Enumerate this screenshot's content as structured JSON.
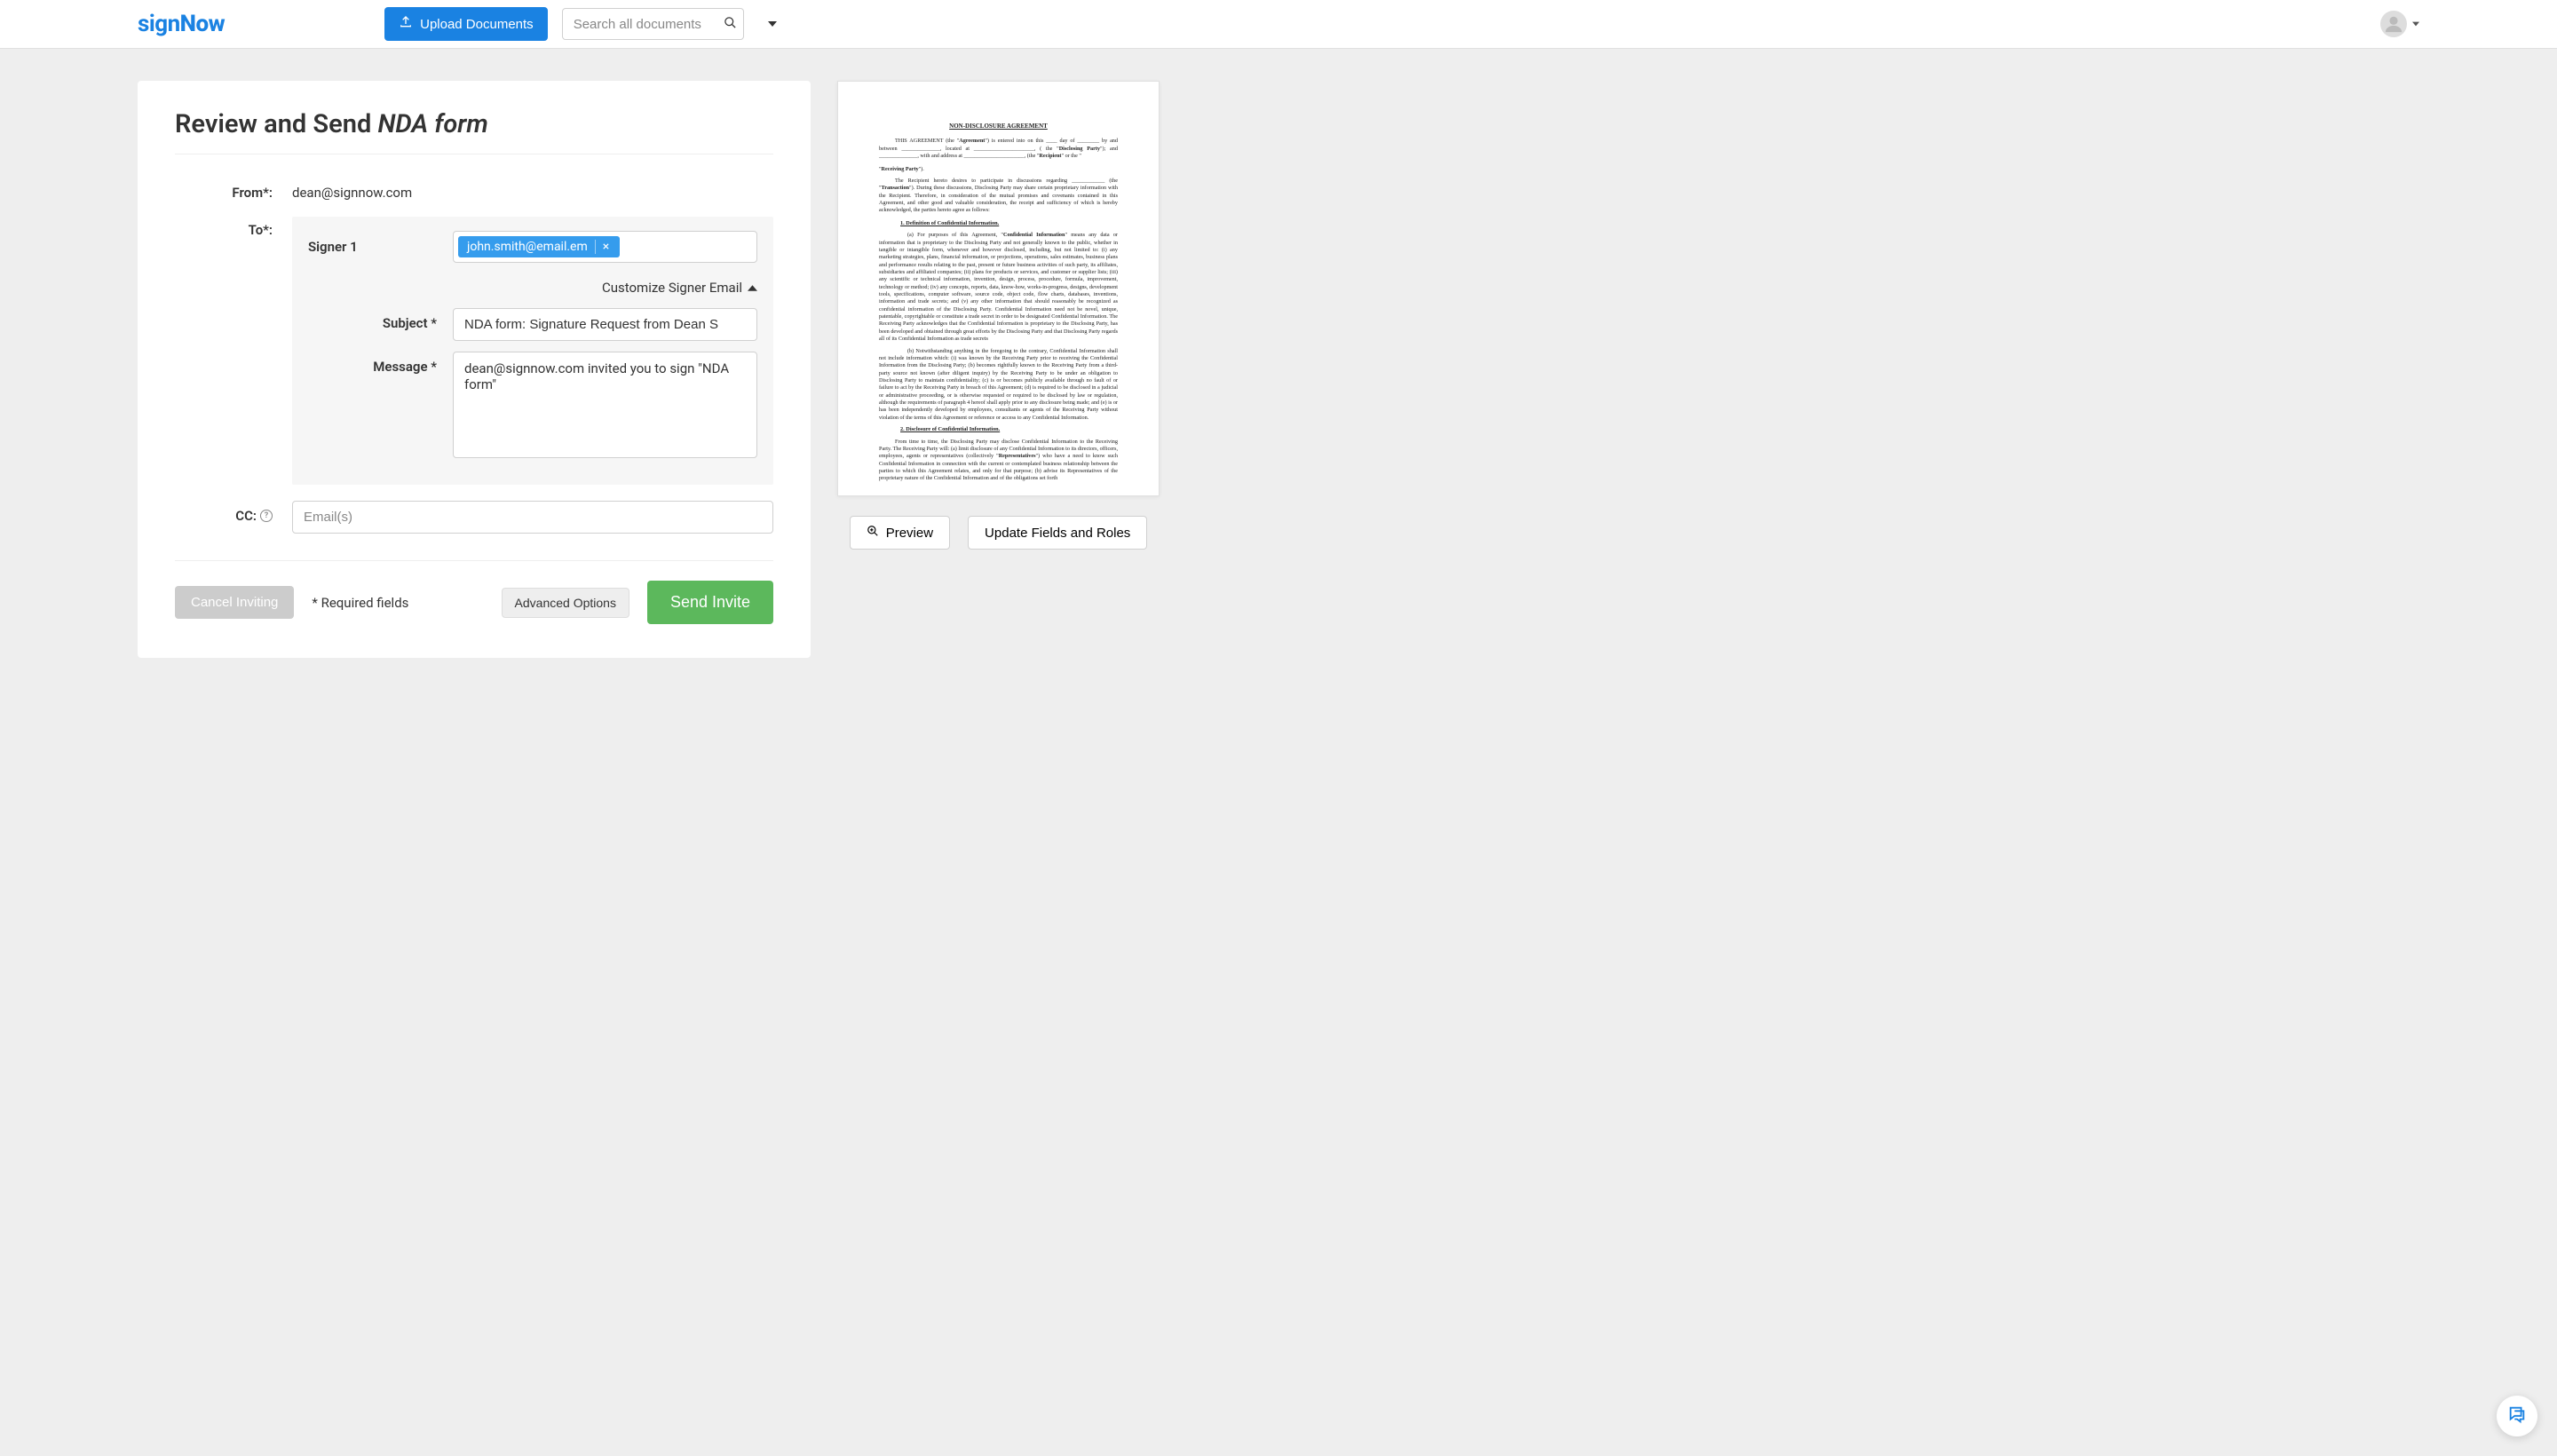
{
  "header": {
    "logo_sign": "sign",
    "logo_now": "Now",
    "upload_label": "Upload Documents",
    "search_placeholder": "Search all documents"
  },
  "page": {
    "title_prefix": "Review and Send ",
    "title_doc": "NDA form",
    "from_label": "From*:",
    "from_value": "dean@signnow.com",
    "to_label": "To*:",
    "signer_label": "Signer 1",
    "signer_email": "john.smith@email.em",
    "customize_label": "Customize Signer Email",
    "subject_label": "Subject *",
    "subject_value": "NDA form: Signature Request from Dean S",
    "message_label": "Message *",
    "message_value": "dean@signnow.com invited you to sign \"NDA form\"",
    "cc_label": "CC:",
    "cc_placeholder": "Email(s)",
    "cancel_label": "Cancel Inviting",
    "required_note": "* Required fields",
    "advanced_label": "Advanced Options",
    "send_label": "Send Invite"
  },
  "preview_actions": {
    "preview_label": "Preview",
    "update_label": "Update Fields and Roles"
  },
  "doc": {
    "title": "NON-DISCLOSURE AGREEMENT",
    "p1_a": "THIS AGREEMENT (the \"",
    "p1_b": "Agreement",
    "p1_c": "\") is entered into on this ____ day of ________ by and between ______________, located at ______________________, ( the \"",
    "p1_d": "Disclosing Party",
    "p1_e": "\"); and ______________, with and address at ______________________, (the \"",
    "p1_f": "Recipient",
    "p1_g": "\" or the \"",
    "p1_h": "Receiving Party",
    "p1_i": "\").",
    "p2_a": "The Recipient hereto desires to participate in discussions regarding ____________ (the \"",
    "p2_b": "Transaction",
    "p2_c": "\").   During these discussions, Disclosing Party may share certain proprietary information with the Recipient.  Therefore, in consideration of the mutual promises and covenants contained in this Agreement, and other good and valuable consideration, the receipt and sufficiency of which is hereby acknowledged, the parties hereto agree as follows:",
    "s1": "1.        Definition of Confidential Information.",
    "p3_a": "(a)      For purposes of this Agreement, \"",
    "p3_b": "Confidential Information",
    "p3_c": "\" means any data or information that is proprietary to the Disclosing Party and not generally known to the public, whether in tangible or intangible form, whenever and however disclosed, including, but not limited to: (i) any marketing strategies, plans, financial information, or projections, operations, sales estimates, business plans and performance results relating to the past, present or future business activities of such party, its affiliates, subsidiaries and affiliated companies; (ii) plans for products or services, and customer or supplier lists; (iii) any scientific or technical information, invention, design, process, procedure, formula, improvement, technology or method; (iv) any concepts, reports, data, know-how, works-in-progress, designs, development tools, specifications, computer software, source code, object code, flow charts, databases, inventions, information and trade secrets; and (v) any other information that should reasonably be recognized as confidential information of the Disclosing Party.  Confidential Information need not be novel, unique, patentable, copyrightable or constitute a trade secret in order to be designated Confidential Information.  The Receiving Party acknowledges that the Confidential Information is proprietary to the Disclosing Party, has been developed and obtained through great efforts by the Disclosing Party and that Disclosing Party regards all of its Confidential Information as trade secrets",
    "p4": "(b)      Notwithstanding anything in the foregoing to the contrary, Confidential Information shall not include information which: (i) was known by the Receiving Party prior to receiving the Confidential Information from the Disclosing Party; (b) becomes rightfully known to the Receiving Party from a third-party source not known (after diligent inquiry) by the Receiving Party to be under an obligation to Disclosing Party to maintain confidentiality; (c) is or becomes publicly available through no fault of or failure to act by the Receiving Party in breach of this Agreement; (d) is required to be disclosed in a judicial or administrative proceeding, or is otherwise requested or required to be disclosed by law or regulation, although the requirements of paragraph 4 hereof shall apply prior to any disclosure being made; and (e) is or has been independently developed by employees, consultants or agents of the Receiving Party without violation of the terms of this Agreement or reference or access to any Confidential Information.",
    "s2": "2.        Disclosure of Confidential Information.",
    "p5_a": "From time to time, the Disclosing Party may disclose Confidential Information to the Receiving Party.  The Receiving Party will:  (a) limit disclosure of any Confidential Information to its directors, officers, employees, agents or representatives (collectively \"",
    "p5_b": "Representatives",
    "p5_c": "\") who have a need to know such Confidential Information in connection with the current or contemplated business relationship between the parties to which this Agreement relates, and only for that purpose; (b) advise its Representatives of the proprietary nature of the Confidential Information and of the obligations set forth"
  }
}
